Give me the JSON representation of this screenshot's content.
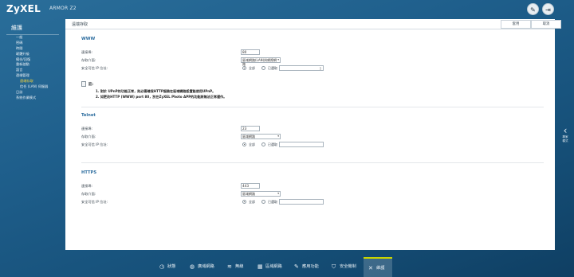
{
  "header": {
    "brand": "ZyXEL",
    "model": "ARMOR Z2",
    "tools_icon": "wrench-icon",
    "exit_icon": "logout-icon"
  },
  "sidebar": {
    "title": "維護",
    "items": [
      {
        "label": "一般",
        "sub": false,
        "active": false
      },
      {
        "label": "密碼",
        "sub": false,
        "active": false
      },
      {
        "label": "時間",
        "sub": false,
        "active": false
      },
      {
        "label": "韌體升級",
        "sub": false,
        "active": false
      },
      {
        "label": "備份/回復",
        "sub": false,
        "active": false
      },
      {
        "label": "重新啟動",
        "sub": false,
        "active": false
      },
      {
        "label": "語言",
        "sub": false,
        "active": false
      },
      {
        "label": "遠端管理",
        "sub": false,
        "active": false
      },
      {
        "label": "遠端存取",
        "sub": true,
        "active": true
      },
      {
        "label": "信任 (LAN) 伺服器",
        "sub": true,
        "active": false
      },
      {
        "label": "日誌",
        "sub": false,
        "active": false
      },
      {
        "label": "系統作業模式",
        "sub": false,
        "active": false
      }
    ]
  },
  "side_tab": {
    "label_1": "專家",
    "label_2": "模式"
  },
  "panel": {
    "title": "遠端存取",
    "apply_label": "套用",
    "cancel_label": "取消",
    "sections": {
      "www": {
        "title": "WWW",
        "port_label": "連接埠:",
        "port_value": "80",
        "access_label": "存取介面:",
        "access_value": "區域網路(LAN)與網際網路",
        "ip_label": "安全可信 IP 位址:",
        "radio_all": "全部",
        "radio_selected": "已選取"
      },
      "telnet": {
        "title": "Telnet",
        "port_label": "連接埠:",
        "port_value": "23",
        "access_label": "存取介面:",
        "access_value": "區域網路",
        "ip_label": "安全可信 IP 位址:",
        "radio_all": "全部",
        "radio_selected": "已選取"
      },
      "https": {
        "title": "HTTPS",
        "port_label": "連接埠:",
        "port_value": "443",
        "access_label": "存取介面:",
        "access_value": "區域網路",
        "ip_label": "安全可信 IP 位址:",
        "radio_all": "全部",
        "radio_selected": "已選取"
      }
    },
    "note": {
      "title": "註:",
      "line1": "1. 對於 UPnP的功能正常，則必需確保HTTP服務在區域網路設置能使用UPnP。",
      "line2": "2. 如更改HTTP (WWW) port 80，別在ZyXEL Photo APP的功能將無法正常運作。"
    }
  },
  "bottom_nav": [
    {
      "label": "狀態",
      "icon": "status-icon",
      "active": false
    },
    {
      "label": "廣域網路",
      "icon": "globe-icon",
      "active": false
    },
    {
      "label": "無線",
      "icon": "wifi-icon",
      "active": false
    },
    {
      "label": "區域網路",
      "icon": "lan-icon",
      "active": false
    },
    {
      "label": "應用功能",
      "icon": "apps-icon",
      "active": false
    },
    {
      "label": "安全機制",
      "icon": "shield-icon",
      "active": false
    },
    {
      "label": "維護",
      "icon": "maintenance-icon",
      "active": true
    }
  ]
}
